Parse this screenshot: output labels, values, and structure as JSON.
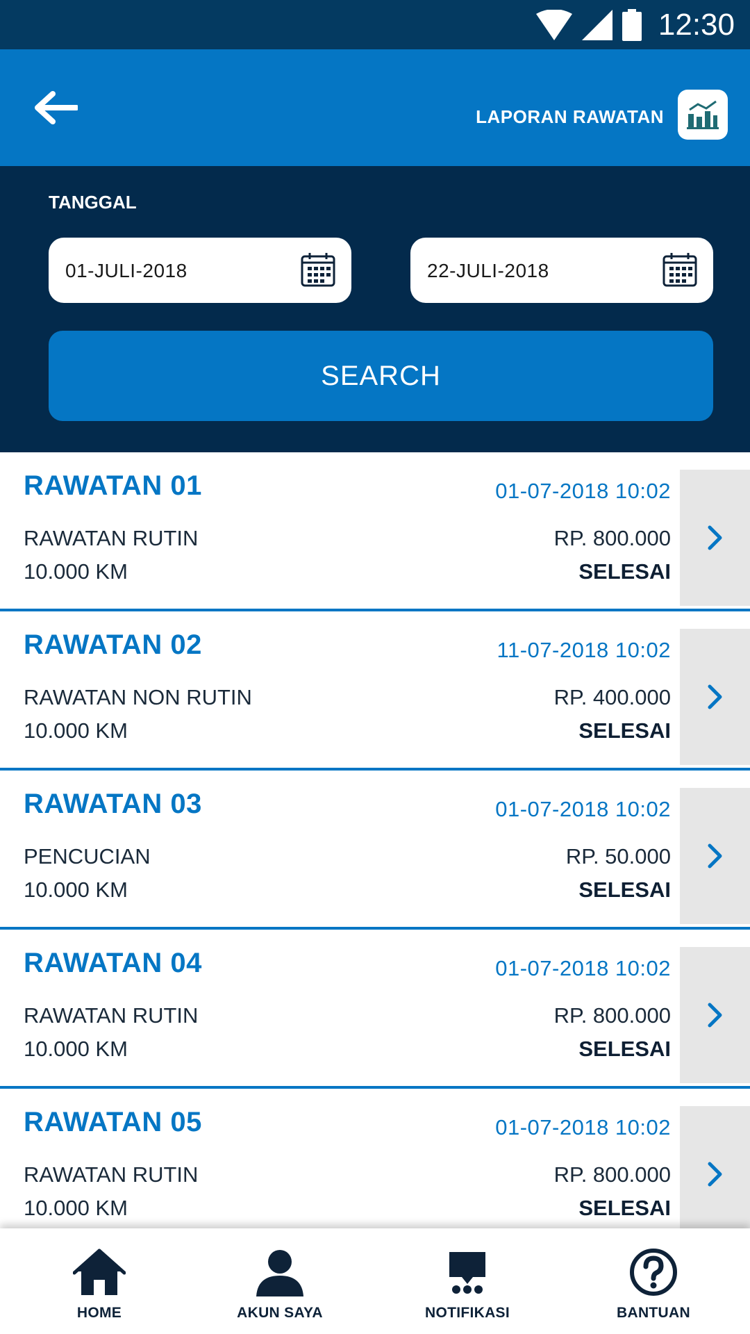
{
  "status_bar": {
    "time": "12:30"
  },
  "app_bar": {
    "title": "LAPORAN RAWATAN"
  },
  "filter": {
    "label": "TANGGAL",
    "start_date": "01-JULI-2018",
    "end_date": "22-JULI-2018",
    "search_label": "SEARCH"
  },
  "records": [
    {
      "title": "RAWATAN 01",
      "datetime": "01-07-2018 10:02",
      "type": "RAWATAN RUTIN",
      "price": "RP. 800.000",
      "km": "10.000 KM",
      "status": "SELESAI"
    },
    {
      "title": "RAWATAN 02",
      "datetime": "11-07-2018 10:02",
      "type": "RAWATAN NON RUTIN",
      "price": "RP. 400.000",
      "km": "10.000 KM",
      "status": "SELESAI"
    },
    {
      "title": "RAWATAN 03",
      "datetime": "01-07-2018 10:02",
      "type": "PENCUCIAN",
      "price": "RP. 50.000",
      "km": "10.000 KM",
      "status": "SELESAI"
    },
    {
      "title": "RAWATAN 04",
      "datetime": "01-07-2018 10:02",
      "type": "RAWATAN RUTIN",
      "price": "RP. 800.000",
      "km": "10.000 KM",
      "status": "SELESAI"
    },
    {
      "title": "RAWATAN 05",
      "datetime": "01-07-2018 10:02",
      "type": "RAWATAN RUTIN",
      "price": "RP. 800.000",
      "km": "10.000 KM",
      "status": "SELESAI"
    }
  ],
  "bottom_nav": {
    "items": [
      {
        "label": "HOME",
        "icon": "home-icon"
      },
      {
        "label": "AKUN SAYA",
        "icon": "user-icon"
      },
      {
        "label": "NOTIFIKASI",
        "icon": "notification-icon"
      },
      {
        "label": "BANTUAN",
        "icon": "help-icon"
      }
    ]
  },
  "colors": {
    "primary": "#0576c4",
    "dark_panel": "#032a4c",
    "status_bar": "#043a61",
    "arrow_bg": "#e6e6e6"
  }
}
